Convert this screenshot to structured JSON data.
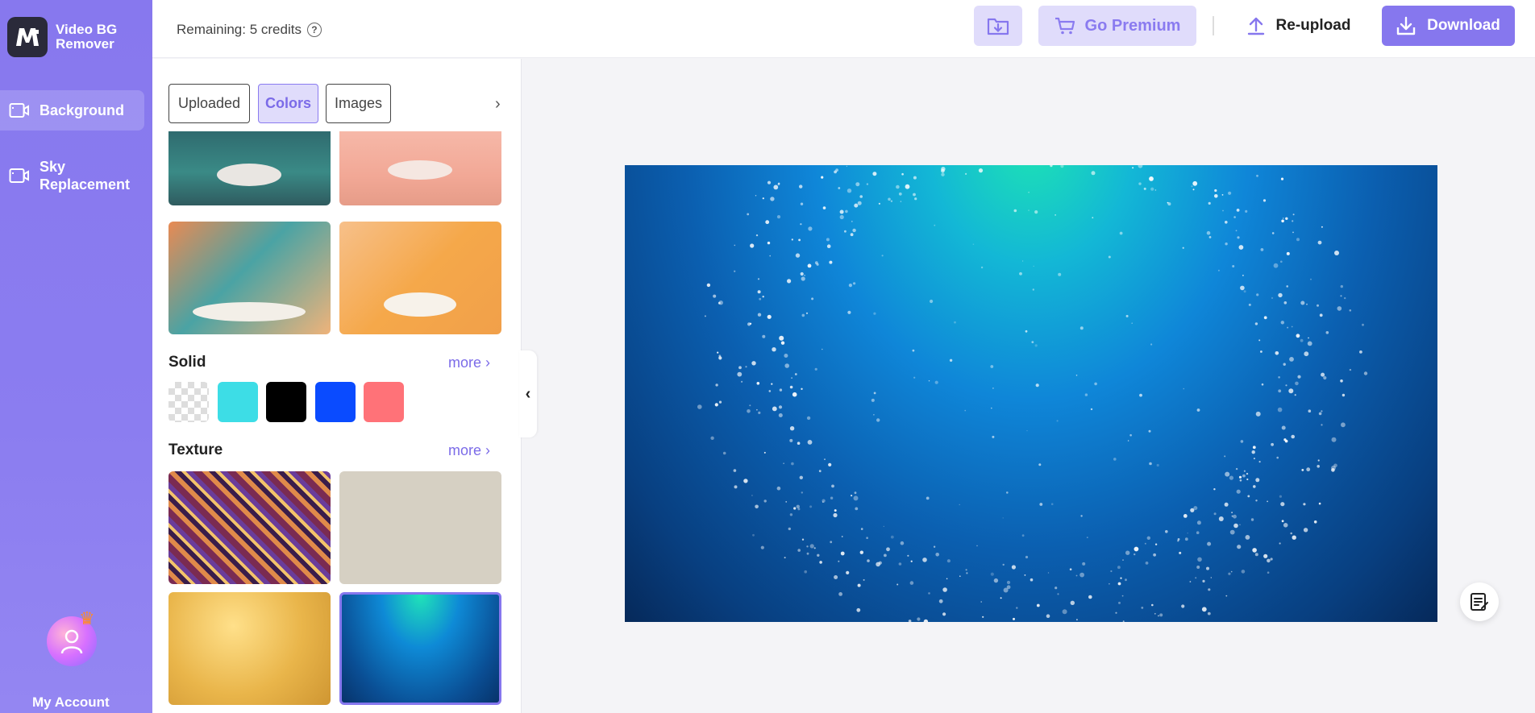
{
  "app": {
    "name": "Video BG Remover",
    "name_line1": "Video BG",
    "name_line2": "Remover",
    "logo_icon": "app-logo-icon"
  },
  "sidebar": {
    "items": [
      {
        "label": "Background",
        "icon": "video-icon",
        "active": true
      },
      {
        "label": "Sky Replacement",
        "icon": "video-icon",
        "active": false
      }
    ],
    "account_label": "My Account"
  },
  "topbar": {
    "credits_text": "Remaining: 5 credits",
    "premium_label": "Go Premium",
    "reupload_label": "Re-upload",
    "download_label": "Download"
  },
  "panel": {
    "tabs": [
      {
        "label": "Uploaded",
        "active": false
      },
      {
        "label": "Colors",
        "active": true
      },
      {
        "label": "Images",
        "active": false
      }
    ],
    "solid": {
      "title": "Solid",
      "more": "more",
      "swatches": [
        "transparent",
        "#3ddde6",
        "#000000",
        "#0a4bff",
        "#ff7278"
      ]
    },
    "texture": {
      "title": "Texture",
      "more": "more"
    }
  },
  "colors": {
    "accent": "#8677ee",
    "accent_light": "#e0dcfb",
    "sidebar_bg": "#8778ee"
  }
}
